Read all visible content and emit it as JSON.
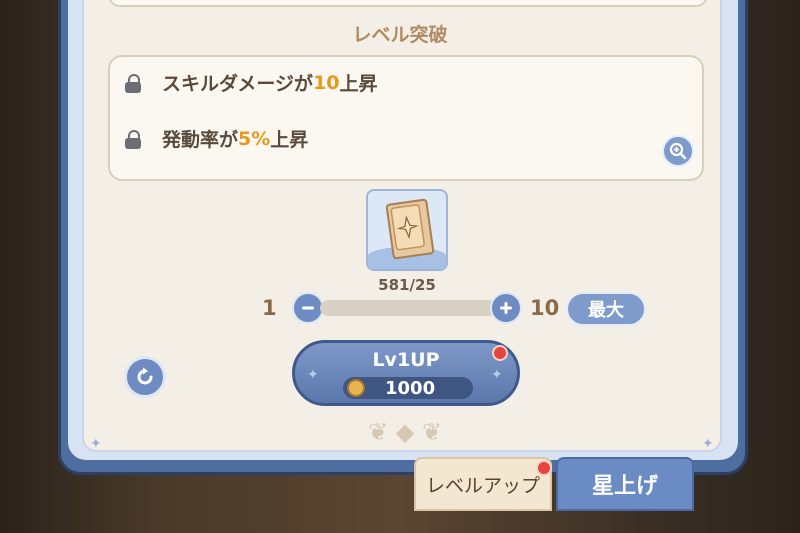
{
  "section_title": "レベル突破",
  "effects": [
    {
      "prefix": "スキルダメージが",
      "value": "10",
      "suffix": "上昇"
    },
    {
      "prefix": "発動率が",
      "value": "5%",
      "suffix": "上昇"
    }
  ],
  "icons": {
    "lock": "lock-icon",
    "zoom": "magnifier-plus-icon",
    "minus": "minus-icon",
    "plus": "plus-icon",
    "reset": "refresh-icon",
    "coin": "coin-icon",
    "card": "skill-card-icon"
  },
  "material": {
    "count": "581/25"
  },
  "slider": {
    "min": "1",
    "max": "10",
    "max_button": "最大",
    "value_fraction": 0
  },
  "level_up_button": {
    "title": "Lv1UP",
    "cost": "1000"
  },
  "tabs": {
    "level_up": "レベルアップ",
    "star_up": "星上げ"
  },
  "colors": {
    "accent_orange": "#e59a1f",
    "button_blue": "#6e8cc2",
    "notification_red": "#e5453a"
  }
}
